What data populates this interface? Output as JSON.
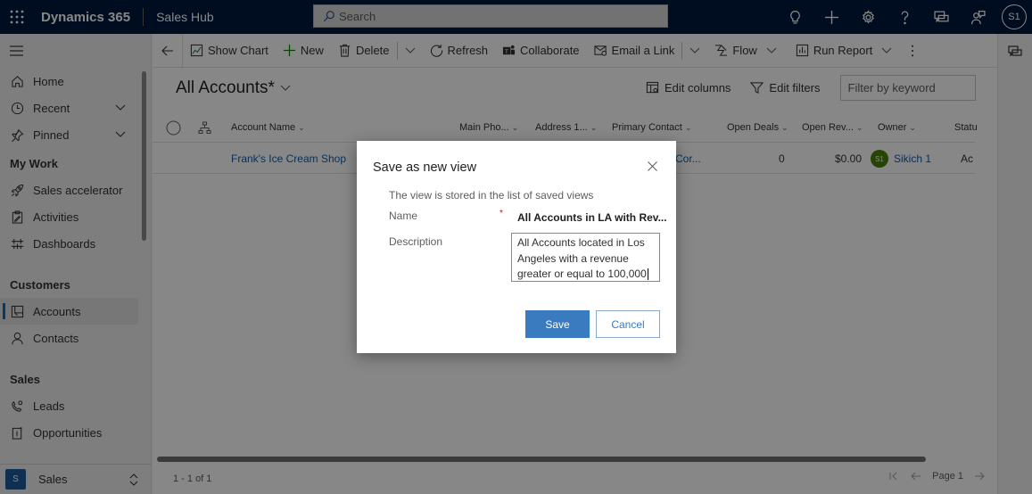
{
  "topbar": {
    "brand": "Dynamics 365",
    "app_name": "Sales Hub",
    "search_placeholder": "Search",
    "user_initials": "S1"
  },
  "commandbar": {
    "show_chart": "Show Chart",
    "new": "New",
    "delete": "Delete",
    "refresh": "Refresh",
    "collaborate": "Collaborate",
    "email_link": "Email a Link",
    "flow": "Flow",
    "run_report": "Run Report"
  },
  "sidebar": {
    "top_items": [
      {
        "label": "Home"
      },
      {
        "label": "Recent"
      },
      {
        "label": "Pinned"
      }
    ],
    "sections": [
      {
        "title": "My Work",
        "items": [
          {
            "label": "Sales accelerator"
          },
          {
            "label": "Activities"
          },
          {
            "label": "Dashboards"
          }
        ]
      },
      {
        "title": "Customers",
        "items": [
          {
            "label": "Accounts",
            "active": true
          },
          {
            "label": "Contacts"
          }
        ]
      },
      {
        "title": "Sales",
        "items": [
          {
            "label": "Leads"
          },
          {
            "label": "Opportunities"
          }
        ]
      }
    ],
    "area": {
      "badge": "S",
      "label": "Sales"
    }
  },
  "main": {
    "view_title": "All Accounts*",
    "edit_columns": "Edit columns",
    "edit_filters": "Edit filters",
    "filter_placeholder": "Filter by keyword",
    "columns": [
      "Account Name",
      "Main Pho...",
      "Address 1...",
      "Primary Contact",
      "Open Deals",
      "Open Rev...",
      "Owner",
      "Statu"
    ],
    "rows": [
      {
        "account_name": "Frank's Ice Cream Shop",
        "primary_contact": "Cor...",
        "open_deals": "0",
        "open_revenue": "$0.00",
        "owner_initials": "S1",
        "owner": "Sikich 1",
        "status": "Ac"
      }
    ],
    "record_count": "1 - 1 of 1",
    "page_label": "Page 1"
  },
  "dialog": {
    "title": "Save as new view",
    "subtitle": "The view is stored in the list of saved views",
    "name_label": "Name",
    "required_mark": "*",
    "name_value": "All Accounts in LA with Rev...",
    "description_label": "Description",
    "description_value": "All Accounts located in Los Angeles with a revenue greater or equal to 100,000",
    "save_label": "Save",
    "cancel_label": "Cancel"
  },
  "colors": {
    "topbar_bg": "#001a3d",
    "primary_button": "#3a7bc0",
    "link": "#115ea3",
    "owner_badge": "#498205",
    "required": "#a4262c"
  }
}
